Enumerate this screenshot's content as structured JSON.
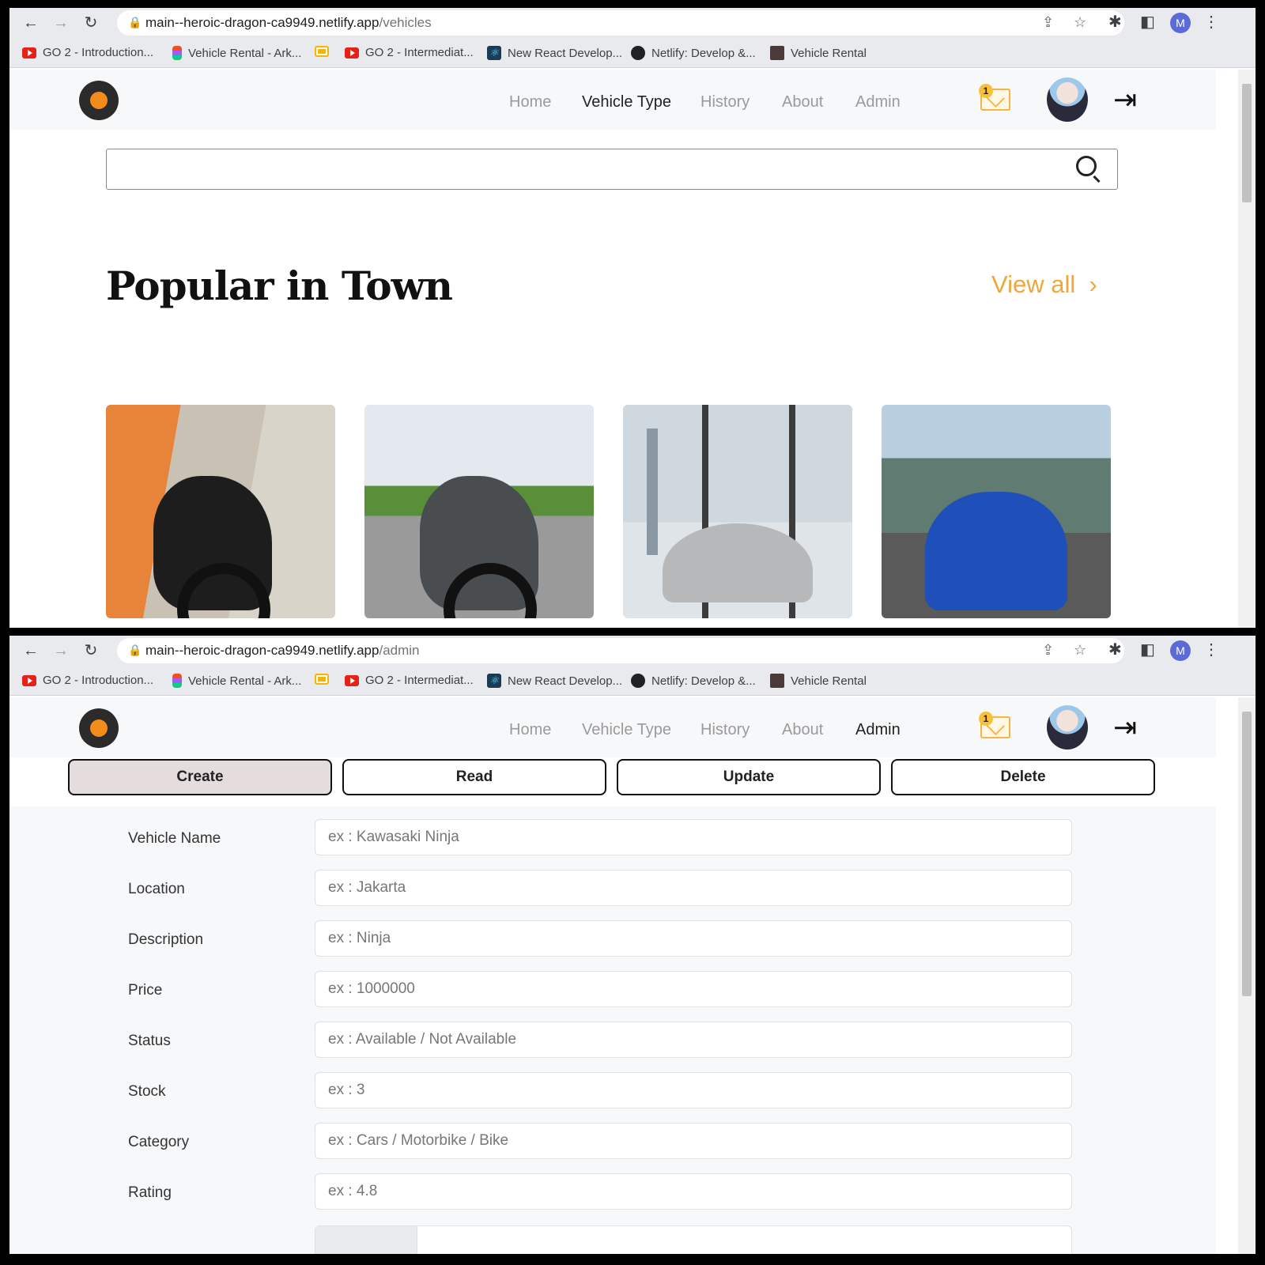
{
  "browser": {
    "top_url": {
      "host": "main--heroic-dragon-ca9949.netlify.app",
      "path": "/vehicles"
    },
    "bottom_url": {
      "host": "main--heroic-dragon-ca9949.netlify.app",
      "path": "/admin"
    },
    "profile_initial": "M",
    "bookmarks": [
      {
        "label": "GO 2 - Introduction...",
        "icon": "youtube-icon"
      },
      {
        "label": "Vehicle Rental - Ark...",
        "icon": "figma-icon"
      },
      {
        "label": "",
        "icon": "slides-icon"
      },
      {
        "label": "GO 2 - Intermediat...",
        "icon": "youtube-icon"
      },
      {
        "label": "New React Develop...",
        "icon": "react-icon"
      },
      {
        "label": "Netlify: Develop &...",
        "icon": "netlify-icon"
      },
      {
        "label": "Vehicle Rental",
        "icon": "vehicle-rental-icon"
      }
    ]
  },
  "nav": {
    "items": [
      "Home",
      "Vehicle Type",
      "History",
      "About",
      "Admin"
    ],
    "mail_count": "1"
  },
  "vehicles_page": {
    "title": "Popular in Town",
    "view_all": "View all",
    "active_nav": "Vehicle Type"
  },
  "admin_page": {
    "active_nav": "Admin",
    "tabs": [
      "Create",
      "Read",
      "Update",
      "Delete"
    ],
    "active_tab": "Create",
    "fields": [
      {
        "label": "Vehicle Name",
        "placeholder": "ex : Kawasaki Ninja"
      },
      {
        "label": "Location",
        "placeholder": "ex : Jakarta"
      },
      {
        "label": "Description",
        "placeholder": "ex : Ninja"
      },
      {
        "label": "Price",
        "placeholder": "ex : 1000000"
      },
      {
        "label": "Status",
        "placeholder": "ex : Available / Not Available"
      },
      {
        "label": "Stock",
        "placeholder": "ex : 3"
      },
      {
        "label": "Category",
        "placeholder": "ex : Cars / Motorbike / Bike"
      },
      {
        "label": "Rating",
        "placeholder": "ex : 4.8"
      }
    ]
  },
  "colors": {
    "accent": "#f0a63a",
    "logo_orange": "#f28c1b"
  }
}
